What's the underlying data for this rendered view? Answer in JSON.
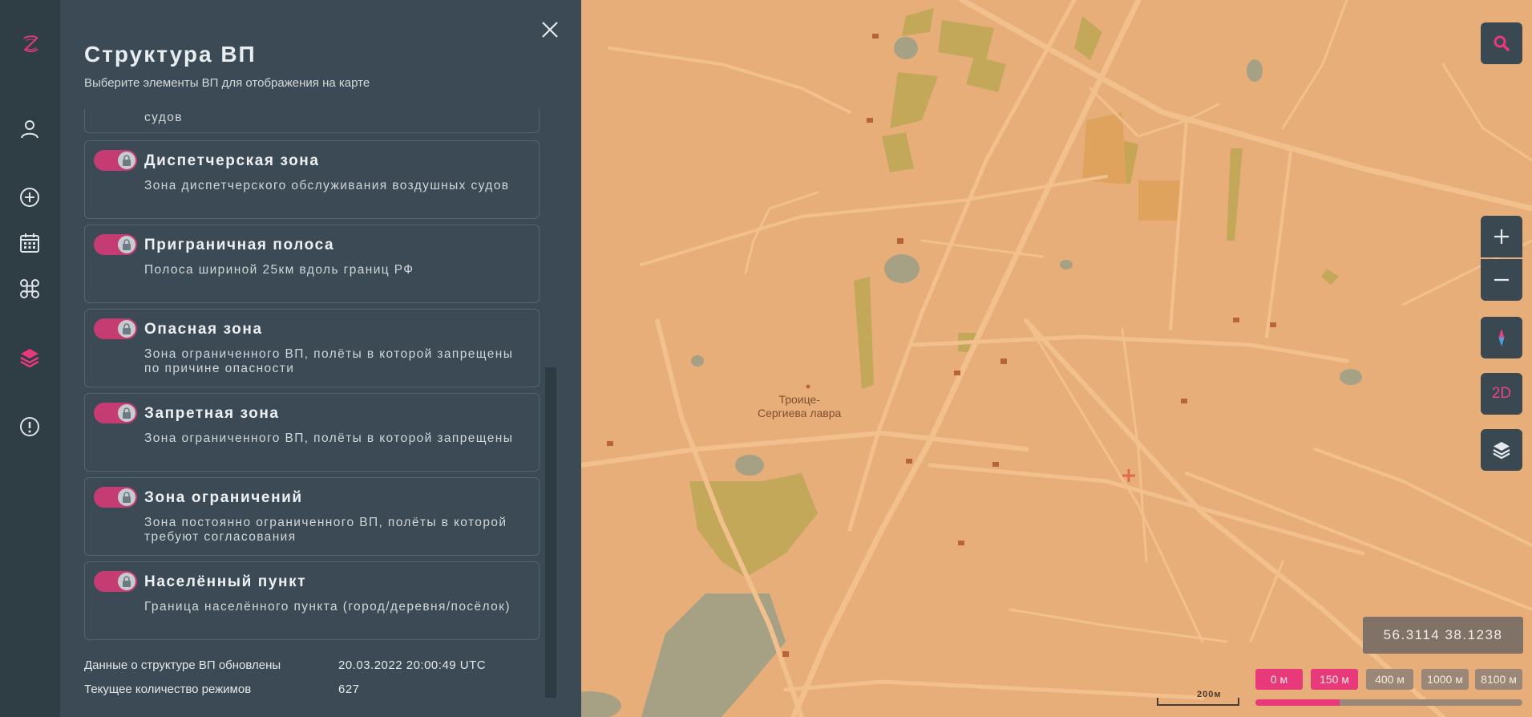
{
  "panel": {
    "title": "Структура ВП",
    "subtitle": "Выберите элементы ВП для отображения на карте",
    "partial_item_desc": "судов",
    "items": [
      {
        "title": "Диспетчерская зона",
        "desc": "Зона диспетчерского обслуживания воздушных судов",
        "enabled": true
      },
      {
        "title": "Приграничная полоса",
        "desc": "Полоса шириной 25км вдоль границ РФ",
        "enabled": true
      },
      {
        "title": "Опасная зона",
        "desc": "Зона ограниченного ВП, полёты в которой запрещены по причине опасности",
        "enabled": true
      },
      {
        "title": "Запретная зона",
        "desc": "Зона ограниченного ВП, полёты в которой запрещены",
        "enabled": true
      },
      {
        "title": "Зона ограничений",
        "desc": "Зона постоянно ограниченного ВП, полёты в которой требуют согласования",
        "enabled": true
      },
      {
        "title": "Населённый пункт",
        "desc": "Граница населённого пункта (город/деревня/посёлок)",
        "enabled": true
      }
    ],
    "updated_label": "Данные о структуре ВП обновлены",
    "updated_value": "20.03.2022 20:00:49 UTC",
    "modes_label": "Текущее количество режимов",
    "modes_value": "627"
  },
  "rail": {
    "icons": [
      "logo-icon",
      "user-icon",
      "add-circle-icon",
      "calendar-icon",
      "drone-icon",
      "layers-icon",
      "alert-icon"
    ],
    "active": "layers-icon"
  },
  "map": {
    "place_label_line1": "Троице-",
    "place_label_line2": "Сергиева лавра",
    "coordinates": "56.3114 38.1238",
    "view_mode": "2D",
    "scale": "200м",
    "altitudes": [
      "0 м",
      "150 м",
      "400 м",
      "1000 м",
      "8100 м"
    ],
    "altitude_selected": "150 м",
    "altitude_fill_fraction": 0.315
  },
  "colors": {
    "accent": "#e83a7a",
    "panel_bg": "#3b4a54",
    "rail_bg": "#2f3d45",
    "map_bg": "#e8ae7a"
  }
}
